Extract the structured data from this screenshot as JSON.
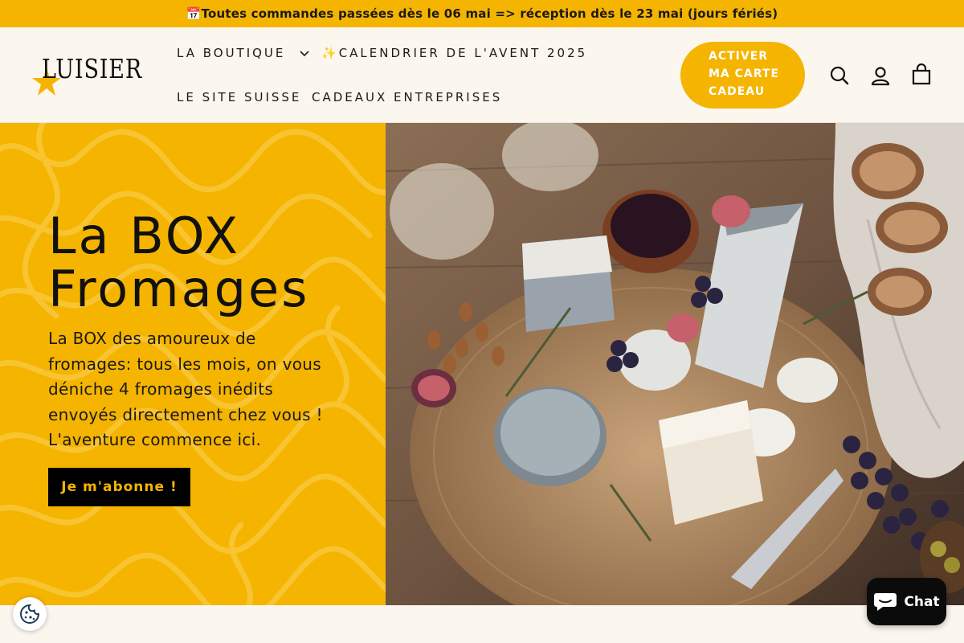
{
  "announcement": {
    "icon": "calendar-icon",
    "emoji": "📅",
    "text": "Toutes commandes passées dès le 06 mai => réception dès le 23 mai (jours fériés)"
  },
  "brand": {
    "logo_text": "LUISIER",
    "accent": "#f5b400"
  },
  "nav": {
    "boutique": "LA BOUTIQUE",
    "avent_icon": "✨",
    "avent": "CALENDRIER DE L'AVENT 2025",
    "suisse": "LE SITE SUISSE",
    "cadeaux": "CADEAUX ENTREPRISES"
  },
  "cta": {
    "line1": "ACTIVER",
    "line2": "MA CARTE",
    "line3": "CADEAU"
  },
  "icons": {
    "search": "search-icon",
    "account": "account-icon",
    "cart": "cart-icon"
  },
  "hero": {
    "title_line1": "La BOX",
    "title_line2": "Fromages",
    "description": "La BOX des amoureux de fromages: tous les mois, on vous déniche 4 fromages inédits envoyés directement chez vous ! L'aventure commence ici.",
    "button": "Je m'abonne !",
    "image_icon": "cheese-platter-image"
  },
  "chat": {
    "label": "Chat",
    "icon": "chat-bubble-icon"
  },
  "cookie": {
    "icon": "cookie-icon"
  }
}
